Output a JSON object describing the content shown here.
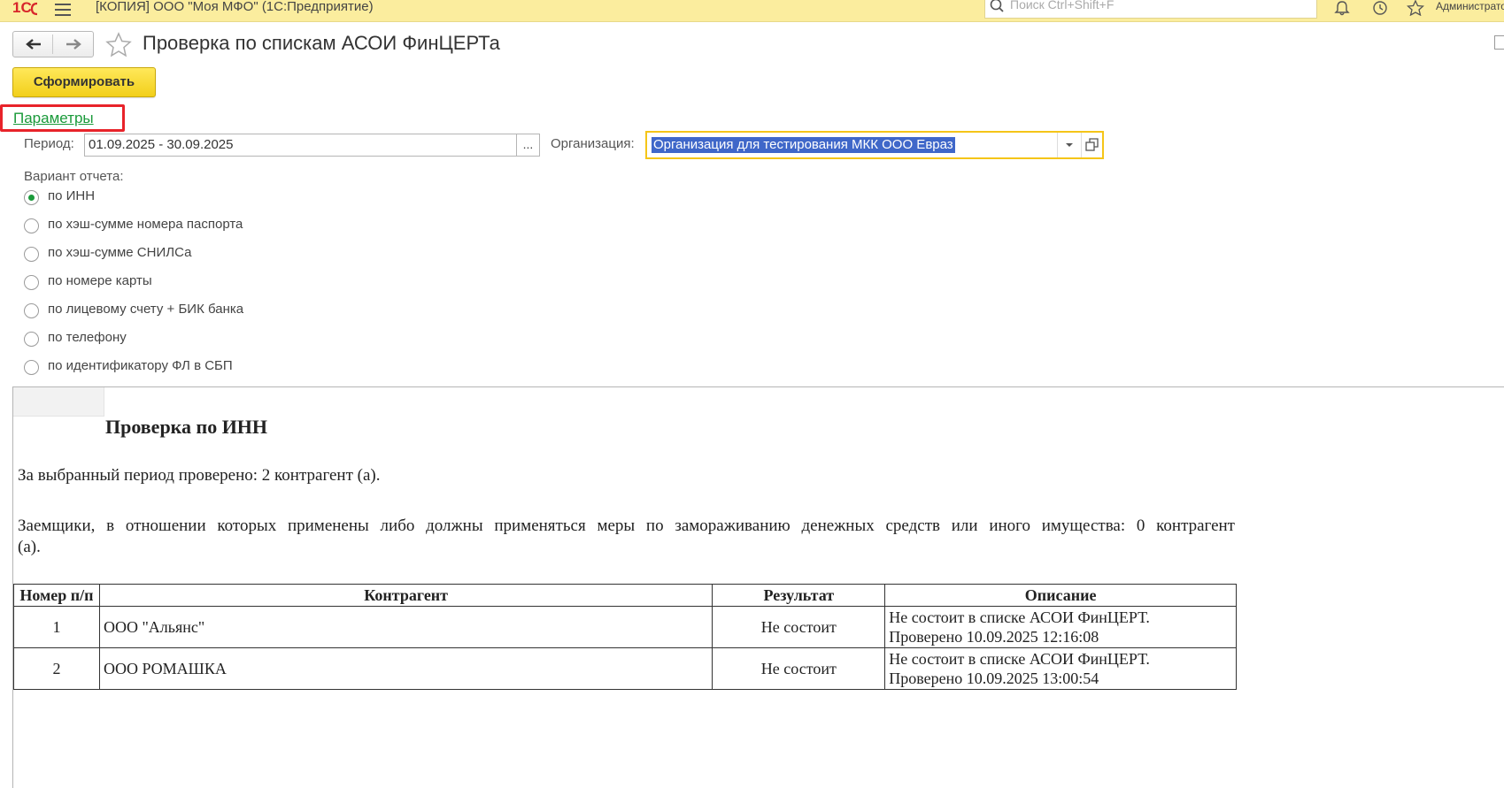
{
  "app": {
    "title": "[КОПИЯ] ООО \"Моя МФО\"  (1С:Предприятие)",
    "search_placeholder": "Поиск Ctrl+Shift+F",
    "user": "Администратор"
  },
  "form": {
    "title": "Проверка по спискам АСОИ ФинЦЕРТа",
    "generate_label": "Сформировать",
    "params_link": "Параметры"
  },
  "params": {
    "period_label": "Период:",
    "period_value": "01.09.2025 - 30.09.2025",
    "period_btn": "...",
    "org_label": "Организация:",
    "org_value": "Организация для тестирования МКК ООО Евраз",
    "variant_label": "Вариант отчета:",
    "variants": [
      {
        "label": "по ИНН",
        "selected": true
      },
      {
        "label": "по хэш-сумме номера паспорта",
        "selected": false
      },
      {
        "label": "по хэш-сумме СНИЛСа",
        "selected": false
      },
      {
        "label": "по номере карты",
        "selected": false
      },
      {
        "label": "по лицевому счету + БИК банка",
        "selected": false
      },
      {
        "label": "по телефону",
        "selected": false
      },
      {
        "label": "по идентификатору ФЛ в СБП",
        "selected": false
      }
    ]
  },
  "report": {
    "title": "Проверка по ИНН",
    "checked_text": "За выбранный период проверено: 2 контрагент (а).",
    "freeze_text_line1": "Заемщики, в отношении которых применены либо должны применяться меры по замораживанию денежных средств или иного имущества: 0 контрагент",
    "freeze_text_line2": "(а).",
    "columns": [
      "Номер п/п",
      "Контрагент",
      "Результат",
      "Описание"
    ],
    "rows": [
      {
        "num": "1",
        "counterparty": "ООО \"Альянс\"",
        "result": "Не состоит",
        "desc1": "Не состоит в списке АСОИ ФинЦЕРТ.",
        "desc2": "Проверено 10.09.2025 12:16:08"
      },
      {
        "num": "2",
        "counterparty": "ООО РОМАШКА",
        "result": "Не состоит",
        "desc1": "Не состоит в списке АСОИ ФинЦЕРТ.",
        "desc2": "Проверено 10.09.2025 13:00:54"
      }
    ]
  },
  "colors": {
    "topbar": "#fbed9e",
    "accent_yellow": "#f2cf1a",
    "link_green": "#1a9a3a",
    "highlight_red": "#e8232a",
    "selection_blue": "#3f67c9"
  },
  "icons": [
    "1c-logo-icon",
    "menu-icon",
    "search-icon",
    "bell-icon",
    "history-icon",
    "star-icon",
    "back-arrow-icon",
    "forward-arrow-icon",
    "favorite-star-icon",
    "dropdown-arrow-icon",
    "open-form-icon"
  ]
}
